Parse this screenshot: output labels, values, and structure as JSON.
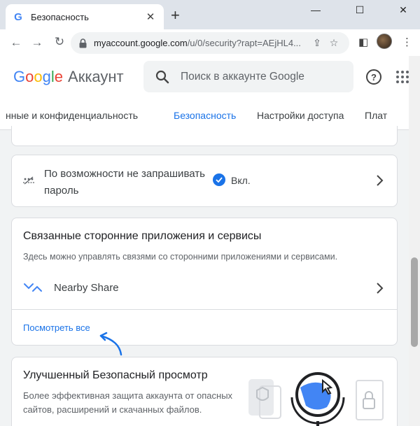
{
  "browser": {
    "tab_title": "Безопасность",
    "tab_favicon": "G",
    "url_host": "myaccount.google.com",
    "url_path": "/u/0/security?rapt=AEjHL4...",
    "icons": [
      "back-arrow",
      "forward-arrow",
      "reload",
      "lock",
      "share",
      "bookmark-star",
      "side-panel",
      "profile-avatar",
      "kebab-menu"
    ]
  },
  "header": {
    "logo_letters": [
      "G",
      "o",
      "o",
      "g",
      "l",
      "e"
    ],
    "product": "Аккаунт",
    "search_placeholder": "Поиск в аккаунте Google"
  },
  "nav_tabs": [
    {
      "label": "нные и конфиденциальность",
      "active": false
    },
    {
      "label": "Безопасность",
      "active": true
    },
    {
      "label": "Настройки доступа",
      "active": false
    },
    {
      "label": "Плат",
      "active": false
    }
  ],
  "password_card": {
    "text": "По возможности не запрашивать пароль",
    "status": "Вкл."
  },
  "apps_card": {
    "title": "Связанные сторонние приложения и сервисы",
    "description": "Здесь можно управлять связями со сторонними приложениями и сервисами.",
    "item_label": "Nearby Share",
    "see_all": "Посмотреть все"
  },
  "safe_browsing_card": {
    "title": "Улучшенный Безопасный просмотр",
    "description": "Более эффективная защита аккаунта от опасных сайтов, расширений и скачанных файлов."
  },
  "colors": {
    "accent": "#1a73e8",
    "google_blue": "#4285f4",
    "google_red": "#ea4335",
    "google_yellow": "#fbbc05",
    "google_green": "#34a853",
    "page_bg": "#f1f3f4"
  }
}
